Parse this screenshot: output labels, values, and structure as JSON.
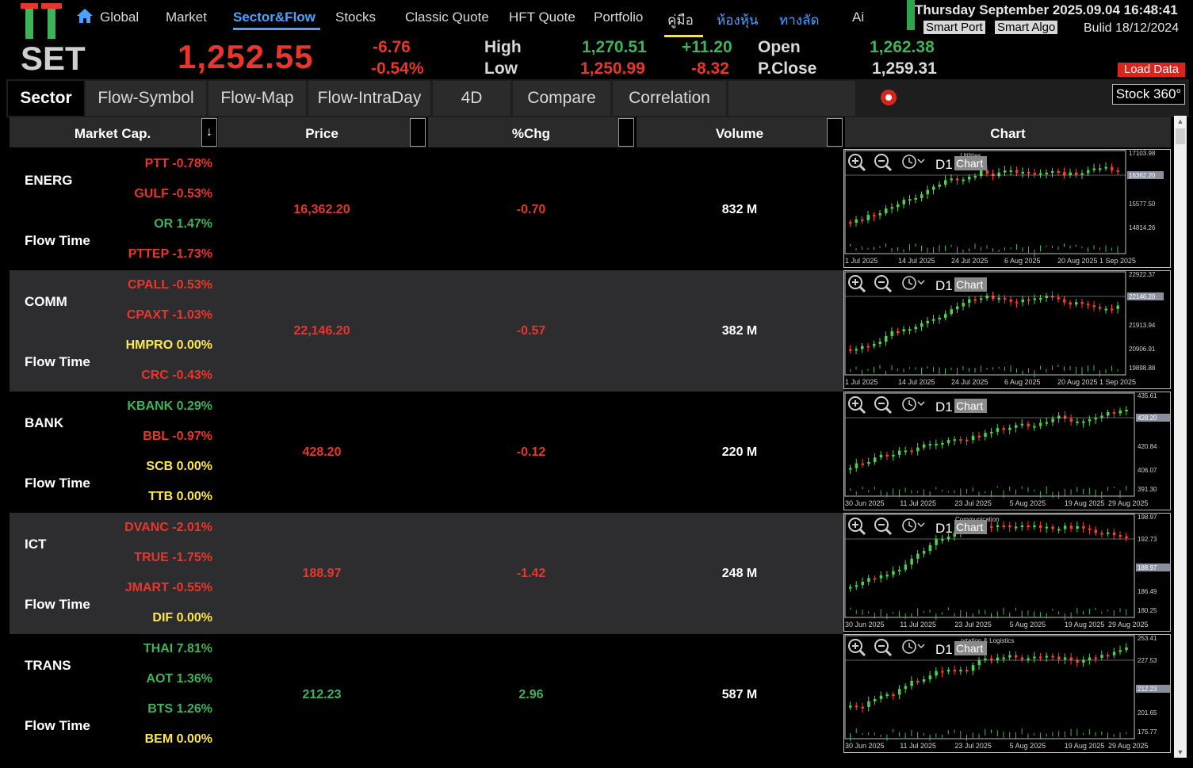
{
  "header": {
    "logo_top": "TT",
    "logo_bottom": "SET",
    "nav": [
      "Global",
      "Market",
      "Sector&Flow",
      "Stocks",
      "Classic Quote",
      "HFT Quote",
      "Portfolio",
      "คู่มือ",
      "ห้องหุ้น",
      "ทางลัด",
      "Ai"
    ],
    "active_nav": "Sector&Flow",
    "index_value": "1,252.55",
    "change": "-6.76",
    "change_pct": "-0.54%",
    "high_label": "High",
    "high_value": "1,270.51",
    "high_diff": "+11.20",
    "low_label": "Low",
    "low_value": "1,250.99",
    "low_diff": "-8.32",
    "open_label": "Open",
    "open_value": "1,262.38",
    "pclose_label": "P.Close",
    "pclose_value": "1,259.31",
    "datetime": "Thursday September 2025.09.04 16:48:41",
    "smart_port": "Smart Port",
    "smart_algo": "Smart Algo",
    "build": "Bulid 18/12/2024",
    "load_data": "Load Data"
  },
  "tabs": [
    "Sector",
    "Flow-Symbol",
    "Flow-Map",
    "Flow-IntraDay",
    "4D",
    "Compare",
    "Correlation"
  ],
  "active_tab": "Sector",
  "stock360": "Stock 360°",
  "columns": {
    "market_cap": "Market Cap.",
    "sort_icon": "↓",
    "price": "Price",
    "chg": "%Chg",
    "volume": "Volume",
    "chart": "Chart"
  },
  "flow_time_label": "Flow Time",
  "sectors": [
    {
      "name": "ENERG",
      "stocks": [
        {
          "text": "PTT -0.78%",
          "color": "red"
        },
        {
          "text": "GULF -0.53%",
          "color": "red"
        },
        {
          "text": "OR 1.47%",
          "color": "green"
        },
        {
          "text": "PTTEP -1.73%",
          "color": "red"
        }
      ],
      "price": "16,362.20",
      "chg": "-0.70",
      "dir": "red",
      "volume": "832 M",
      "chart": {
        "timeframe": "D1",
        "chart_btn": "Chart",
        "title": "...Utilities",
        "last": "16362.20",
        "y_ticks": [
          "17103.98",
          "16362.20",
          "15577.50",
          "14814.26"
        ],
        "x_ticks": [
          "1 Jul 2025",
          "14 Jul 2025",
          "24 Jul 2025",
          "6 Aug 2025",
          "20 Aug 2025",
          "1 Sep 2025"
        ]
      }
    },
    {
      "name": "COMM",
      "stocks": [
        {
          "text": "CPALL -0.53%",
          "color": "red"
        },
        {
          "text": "CPAXT -1.03%",
          "color": "red"
        },
        {
          "text": "HMPRO 0.00%",
          "color": "yellow"
        },
        {
          "text": "CRC -0.43%",
          "color": "red"
        }
      ],
      "price": "22,146.20",
      "chg": "-0.57",
      "dir": "red",
      "volume": "382 M",
      "chart": {
        "timeframe": "D1",
        "chart_btn": "Chart",
        "title": "",
        "last": "22146.20",
        "y_ticks": [
          "22922.37",
          "22146.20",
          "21913.94",
          "20906.91",
          "19898.88"
        ],
        "x_ticks": [
          "1 Jul 2025",
          "14 Jul 2025",
          "24 Jul 2025",
          "6 Aug 2025",
          "20 Aug 2025",
          "1 Sep 2025"
        ]
      }
    },
    {
      "name": "BANK",
      "stocks": [
        {
          "text": "KBANK 0.29%",
          "color": "green"
        },
        {
          "text": "BBL -0.97%",
          "color": "red"
        },
        {
          "text": "SCB 0.00%",
          "color": "yellow"
        },
        {
          "text": "TTB 0.00%",
          "color": "yellow"
        }
      ],
      "price": "428.20",
      "chg": "-0.12",
      "dir": "red",
      "volume": "220 M",
      "chart": {
        "timeframe": "D1",
        "chart_btn": "Chart",
        "title": "",
        "last": "428.20",
        "y_ticks": [
          "435.61",
          "428.20",
          "420.84",
          "406.07",
          "391.30"
        ],
        "x_ticks": [
          "30 Jun 2025",
          "11 Jul 2025",
          "23 Jul 2025",
          "5 Aug 2025",
          "19 Aug 2025",
          "29 Aug 2025"
        ]
      }
    },
    {
      "name": "ICT",
      "stocks": [
        {
          "text": "DVANC -2.01%",
          "color": "red"
        },
        {
          "text": "TRUE -1.75%",
          "color": "red"
        },
        {
          "text": "JMART -0.55%",
          "color": "red"
        },
        {
          "text": "DIF 0.00%",
          "color": "yellow"
        }
      ],
      "price": "188.97",
      "chg": "-1.42",
      "dir": "red",
      "volume": "248 M",
      "chart": {
        "timeframe": "D1",
        "chart_btn": "Chart",
        "title": "Communication",
        "last": "188.97",
        "y_ticks": [
          "198.97",
          "192.73",
          "188.97",
          "186.49",
          "180.25"
        ],
        "x_ticks": [
          "30 Jun 2025",
          "11 Jul 2025",
          "23 Jul 2025",
          "5 Aug 2025",
          "19 Aug 2025",
          "29 Aug 2025"
        ]
      }
    },
    {
      "name": "TRANS",
      "stocks": [
        {
          "text": "THAI 7.81%",
          "color": "green"
        },
        {
          "text": "AOT 1.36%",
          "color": "green"
        },
        {
          "text": "BTS 1.26%",
          "color": "green"
        },
        {
          "text": "BEM 0.00%",
          "color": "yellow"
        }
      ],
      "price": "212.23",
      "chg": "2.96",
      "dir": "green",
      "volume": "587 M",
      "chart": {
        "timeframe": "D1",
        "chart_btn": "Chart",
        "title": "...ortation & Logistics",
        "last": "212.23",
        "y_ticks": [
          "253.41",
          "227.53",
          "212.23",
          "201.65",
          "175.77"
        ],
        "x_ticks": [
          "30 Jun 2025",
          "11 Jul 2025",
          "23 Jul 2025",
          "5 Aug 2025",
          "19 Aug 2025",
          "29 Aug 2025"
        ]
      }
    }
  ],
  "colors": {
    "red": "#e8362d",
    "green": "#3fb35a",
    "yellow": "#ffe84a",
    "nav_active": "#4aa3ff"
  }
}
